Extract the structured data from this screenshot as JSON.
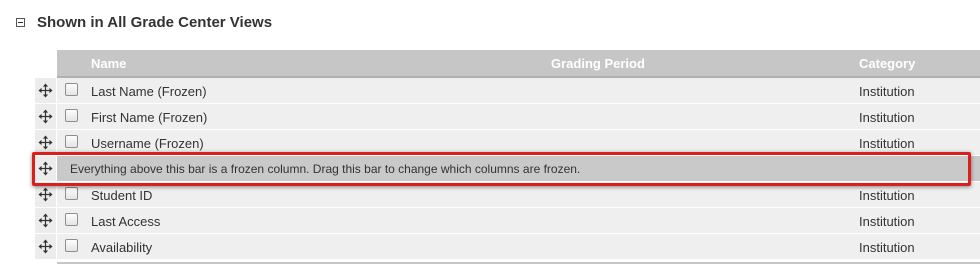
{
  "section": {
    "title": "Shown in All Grade Center Views"
  },
  "columns": {
    "name": "Name",
    "grading_period": "Grading Period",
    "category": "Category"
  },
  "rows_above": [
    {
      "name": "Last Name (Frozen)",
      "category": "Institution",
      "checked": false
    },
    {
      "name": "First Name (Frozen)",
      "category": "Institution",
      "checked": false
    },
    {
      "name": "Username (Frozen)",
      "category": "Institution",
      "checked": false
    }
  ],
  "frozen_bar": {
    "text": "Everything above this bar is a frozen column. Drag this bar to change which columns are frozen."
  },
  "rows_below": [
    {
      "name": "Student ID",
      "category": "Institution",
      "checked": false
    },
    {
      "name": "Last Access",
      "category": "Institution",
      "checked": false
    },
    {
      "name": "Availability",
      "category": "Institution",
      "checked": false
    }
  ],
  "colors": {
    "header_bg": "#c6c6c6",
    "row_bg": "#efefef",
    "frozen_bar_bg": "#c9c9c9",
    "highlight": "#d9201f"
  },
  "icons": {
    "drag": "move-arrows-icon",
    "collapse": "collapse-minus-icon"
  }
}
